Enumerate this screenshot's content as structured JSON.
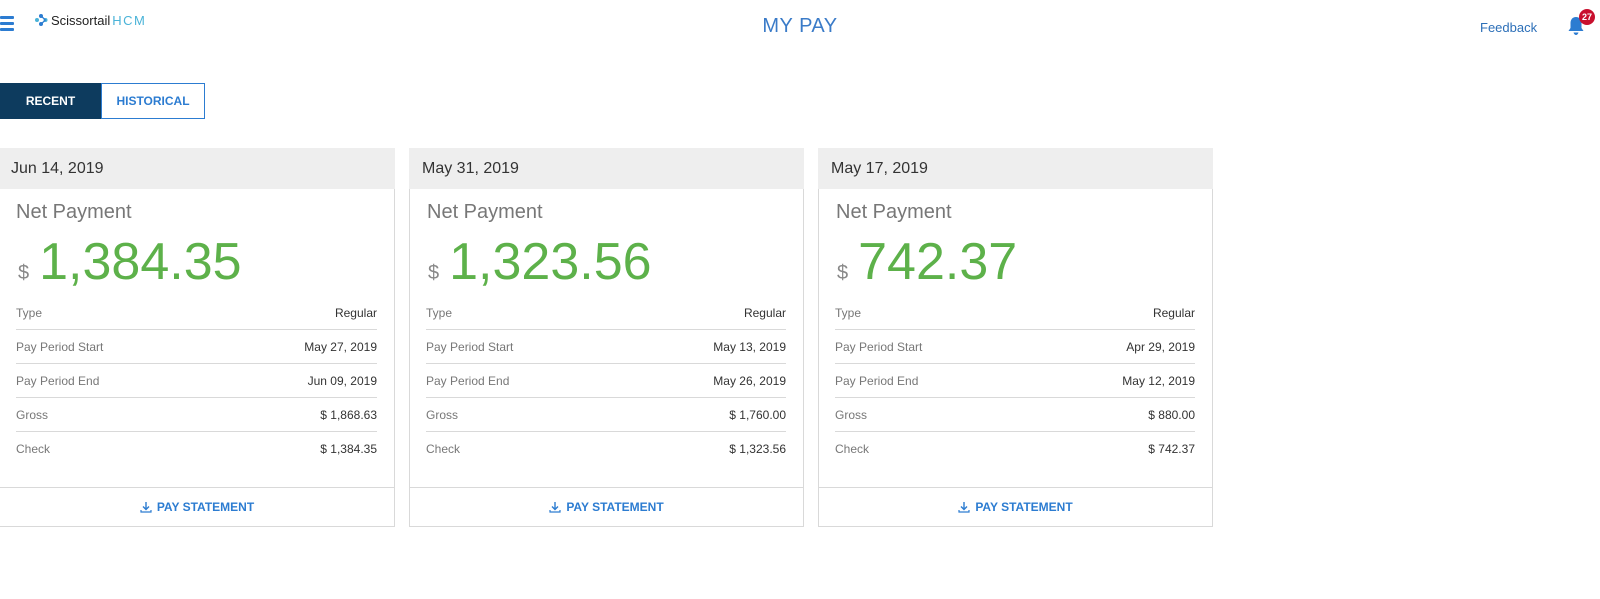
{
  "header": {
    "logo_brand": "Scissortail",
    "logo_suffix": "HCM",
    "title": "MY PAY",
    "feedback_label": "Feedback",
    "notification_count": "27"
  },
  "tabs": [
    {
      "label": "RECENT",
      "active": true
    },
    {
      "label": "HISTORICAL",
      "active": false
    }
  ],
  "colors": {
    "primary": "#2c7cd1",
    "tab_active_bg": "#0d3b5e",
    "amount_green": "#5db14a",
    "badge_red": "#c8102e"
  },
  "cards": [
    {
      "date": "Jun 14, 2019",
      "net_label": "Net Payment",
      "currency": "$",
      "net_amount": "1,384.35",
      "rows": [
        {
          "label": "Type",
          "value": "Regular"
        },
        {
          "label": "Pay Period Start",
          "value": "May 27, 2019"
        },
        {
          "label": "Pay Period End",
          "value": "Jun 09, 2019"
        },
        {
          "label": "Gross",
          "value": "$ 1,868.63"
        },
        {
          "label": "Check",
          "value": "$ 1,384.35"
        }
      ],
      "action_label": "PAY STATEMENT"
    },
    {
      "date": "May 31, 2019",
      "net_label": "Net Payment",
      "currency": "$",
      "net_amount": "1,323.56",
      "rows": [
        {
          "label": "Type",
          "value": "Regular"
        },
        {
          "label": "Pay Period Start",
          "value": "May 13, 2019"
        },
        {
          "label": "Pay Period End",
          "value": "May 26, 2019"
        },
        {
          "label": "Gross",
          "value": "$ 1,760.00"
        },
        {
          "label": "Check",
          "value": "$ 1,323.56"
        }
      ],
      "action_label": "PAY STATEMENT"
    },
    {
      "date": "May 17, 2019",
      "net_label": "Net Payment",
      "currency": "$",
      "net_amount": "742.37",
      "rows": [
        {
          "label": "Type",
          "value": "Regular"
        },
        {
          "label": "Pay Period Start",
          "value": "Apr 29, 2019"
        },
        {
          "label": "Pay Period End",
          "value": "May 12, 2019"
        },
        {
          "label": "Gross",
          "value": "$ 880.00"
        },
        {
          "label": "Check",
          "value": "$ 742.37"
        }
      ],
      "action_label": "PAY STATEMENT"
    }
  ]
}
